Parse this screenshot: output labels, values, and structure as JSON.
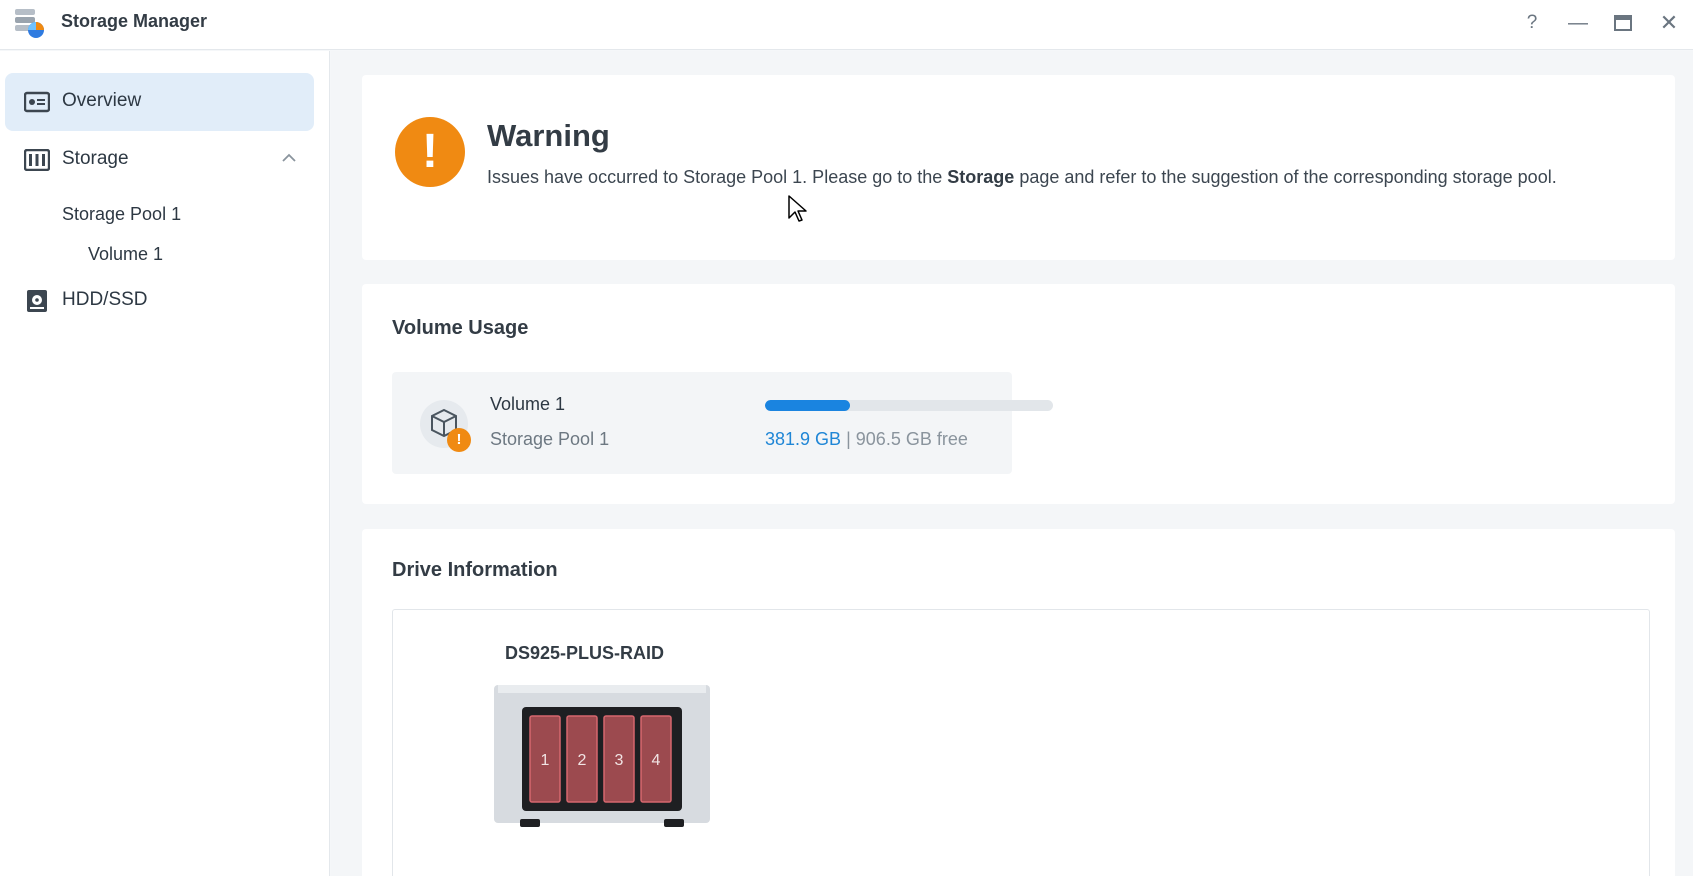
{
  "window": {
    "title": "Storage Manager",
    "help_icon": "question-icon",
    "minimize_icon": "minimize-icon",
    "maximize_icon": "maximize-icon",
    "close_icon": "close-icon"
  },
  "sidebar": {
    "items": [
      {
        "label": "Overview",
        "icon": "overview-icon",
        "active": true
      },
      {
        "label": "Storage",
        "icon": "storage-icon",
        "expanded": true,
        "children": [
          {
            "label": "Storage Pool 1"
          },
          {
            "label": "Volume 1"
          }
        ]
      },
      {
        "label": "HDD/SSD",
        "icon": "hdd-icon"
      }
    ]
  },
  "warning": {
    "title": "Warning",
    "text_before": "Issues have occurred to Storage Pool 1. Please go to the ",
    "text_bold": "Storage",
    "text_after": " page and refer to the suggestion of the corresponding storage pool.",
    "icon": "warning-icon"
  },
  "volume_usage": {
    "title": "Volume Usage",
    "volume_name": "Volume 1",
    "pool_name": "Storage Pool 1",
    "used": "381.9 GB",
    "separator": "|",
    "free": "906.5 GB free",
    "used_fraction": 0.296,
    "status_badge": "!"
  },
  "drive_info": {
    "title": "Drive Information",
    "model": "DS925-PLUS-RAID",
    "bays": [
      "1",
      "2",
      "3",
      "4"
    ]
  },
  "colors": {
    "accent": "#1a84e0",
    "warning": "#f08a12",
    "active_nav": "#e1edf9",
    "drive_bay": "#9c4a4f"
  }
}
